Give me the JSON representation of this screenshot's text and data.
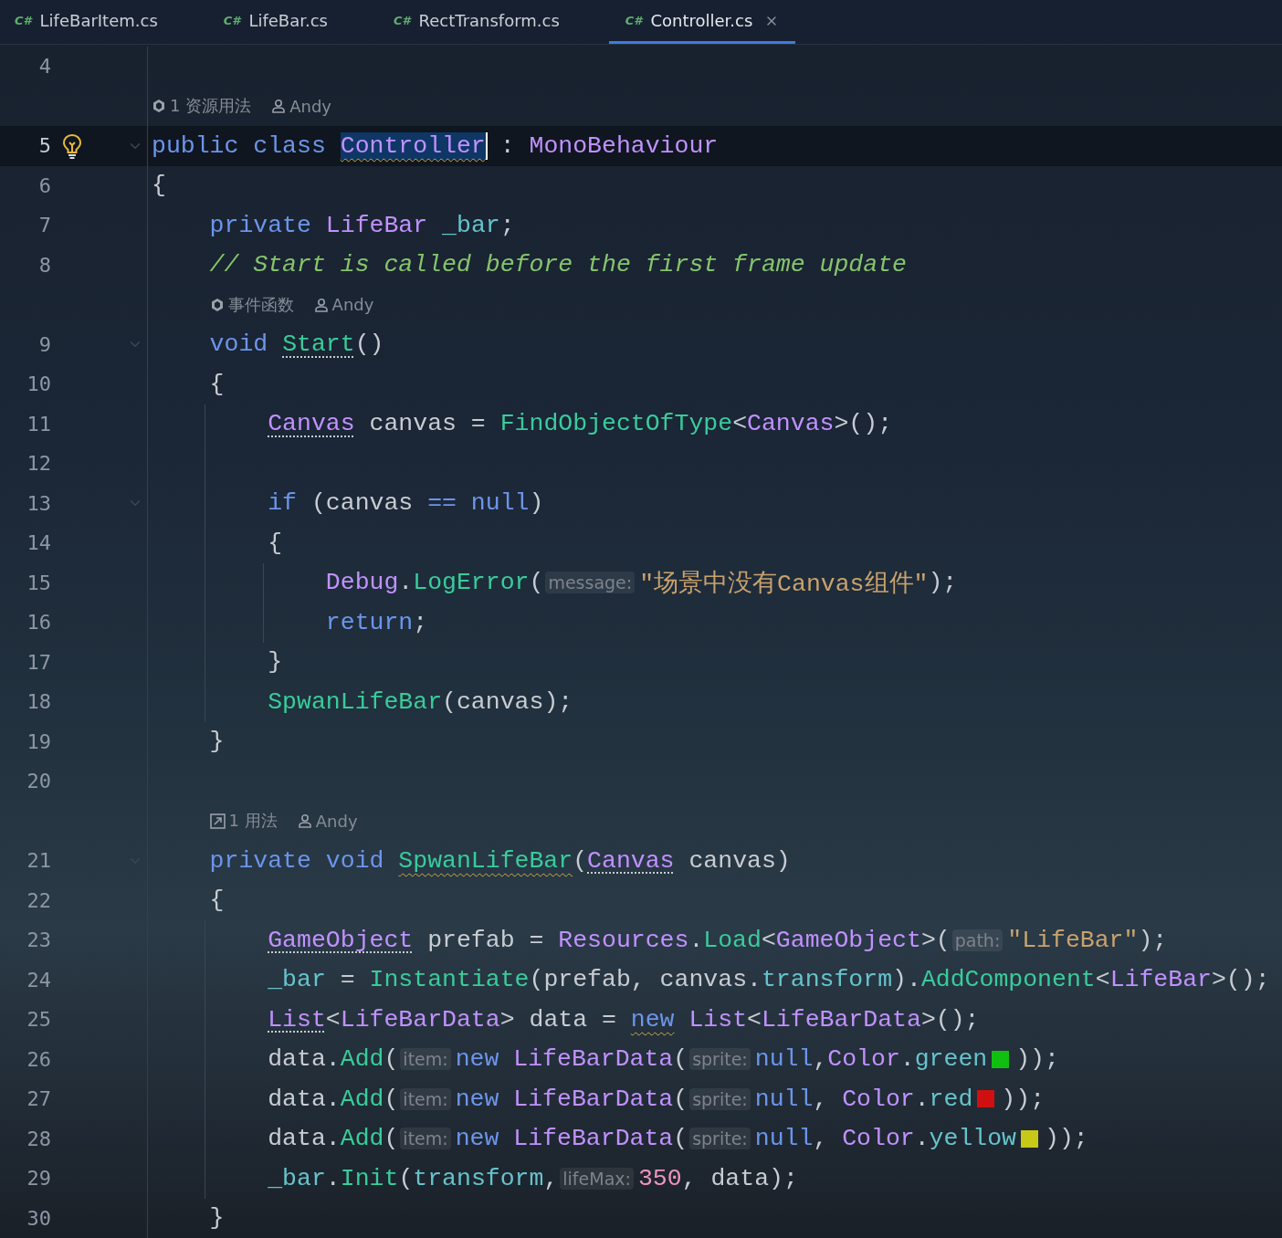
{
  "tabs": [
    {
      "icon_text": "C#",
      "label": "LifeBarItem.cs",
      "selected": false
    },
    {
      "icon_text": "C#",
      "label": "LifeBar.cs",
      "selected": false
    },
    {
      "icon_text": "C#",
      "label": "RectTransform.cs",
      "selected": false
    },
    {
      "icon_text": "C#",
      "label": "Controller.cs",
      "selected": true
    }
  ],
  "lines": [
    {
      "kind": "code",
      "number": "4",
      "current": false,
      "fold": false,
      "bulb": false
    },
    {
      "kind": "lens",
      "items": [
        {
          "kind": "unity",
          "text": "1 资源用法"
        },
        {
          "kind": "user",
          "text": "Andy"
        }
      ]
    },
    {
      "kind": "code",
      "number": "5",
      "current": true,
      "fold": true,
      "bulb": true,
      "tokens": [
        {
          "text": "public class ",
          "kind": "kw"
        },
        {
          "text": "Controller",
          "kind": "type",
          "squiggly": true,
          "caret": true
        },
        {
          "text": " : ",
          "kind": "plain"
        },
        {
          "text": "MonoBehaviour",
          "kind": "type"
        }
      ]
    },
    {
      "kind": "code",
      "number": "6",
      "current": false,
      "fold": false,
      "bulb": false,
      "tokens": [
        {
          "text": "{",
          "kind": "open"
        }
      ]
    },
    {
      "kind": "code",
      "number": "7",
      "current": false,
      "fold": false,
      "bulb": false,
      "tokens": [
        {
          "text": "private",
          "kind": "kw"
        },
        {
          "text": " LifeBar",
          "kind": "type"
        },
        {
          "text": " _bar",
          "kind": "field"
        },
        {
          "text": ";",
          "kind": "plain"
        }
      ]
    },
    {
      "kind": "code",
      "number": "8",
      "current": false,
      "fold": false,
      "bulb": false,
      "tokens": [
        {
          "text": "// Start is called before the first frame update",
          "kind": "comment"
        }
      ]
    },
    {
      "kind": "lens",
      "items": [
        {
          "kind": "unity",
          "text": "事件函数"
        },
        {
          "kind": "user",
          "text": "Andy"
        }
      ]
    },
    {
      "kind": "code",
      "number": "9",
      "current": false,
      "fold": true,
      "bulb": false,
      "tokens": [
        {
          "text": "void ",
          "kind": "kw"
        },
        {
          "text": "Start",
          "kind": "method",
          "dotted": true
        },
        {
          "text": "()",
          "kind": "plain"
        }
      ]
    },
    {
      "kind": "code",
      "number": "10",
      "current": false,
      "fold": false,
      "bulb": false,
      "tokens": [
        {
          "text": "{",
          "kind": "open"
        }
      ]
    },
    {
      "kind": "code",
      "number": "11",
      "current": false,
      "fold": false,
      "bulb": false,
      "tokens": [
        {
          "text": "Canvas",
          "kind": "type",
          "dotted": true
        },
        {
          "text": " canvas = ",
          "kind": "plain"
        },
        {
          "text": "FindObjectOfType",
          "kind": "method"
        },
        {
          "text": "<",
          "kind": "plain"
        },
        {
          "text": "Canvas",
          "kind": "type"
        },
        {
          "text": ">();",
          "kind": "plain"
        }
      ]
    },
    {
      "kind": "code",
      "number": "12",
      "current": false,
      "fold": false,
      "bulb": false
    },
    {
      "kind": "code",
      "number": "13",
      "current": false,
      "fold": true,
      "bulb": false,
      "tokens": [
        {
          "text": "if",
          "kind": "kw"
        },
        {
          "text": " (canvas ",
          "kind": "plain"
        },
        {
          "text": "== null",
          "kind": "kw"
        },
        {
          "text": ")",
          "kind": "plain"
        }
      ]
    },
    {
      "kind": "code",
      "number": "14",
      "current": false,
      "fold": false,
      "bulb": false,
      "tokens": [
        {
          "text": "{",
          "kind": "open"
        }
      ]
    },
    {
      "kind": "code",
      "number": "15",
      "current": false,
      "fold": false,
      "bulb": false,
      "tokens": [
        {
          "text": "Debug",
          "kind": "type"
        },
        {
          "text": ".",
          "kind": "plain"
        },
        {
          "text": "LogError",
          "kind": "method"
        },
        {
          "text": "(",
          "kind": "plain"
        },
        {
          "text": "message:",
          "kind": "hint"
        },
        {
          "text": "\"场景中没有Canvas组件\"",
          "kind": "string"
        },
        {
          "text": ");",
          "kind": "plain"
        }
      ]
    },
    {
      "kind": "code",
      "number": "16",
      "current": false,
      "fold": false,
      "bulb": false,
      "tokens": [
        {
          "text": "return",
          "kind": "kw"
        },
        {
          "text": ";",
          "kind": "plain"
        }
      ]
    },
    {
      "kind": "code",
      "number": "17",
      "current": false,
      "fold": false,
      "bulb": false,
      "tokens": [
        {
          "text": "}",
          "kind": "close"
        }
      ]
    },
    {
      "kind": "code",
      "number": "18",
      "current": false,
      "fold": false,
      "bulb": false,
      "tokens": [
        {
          "text": "SpwanLifeBar",
          "kind": "method"
        },
        {
          "text": "(canvas);",
          "kind": "plain"
        }
      ]
    },
    {
      "kind": "code",
      "number": "19",
      "current": false,
      "fold": false,
      "bulb": false,
      "tokens": [
        {
          "text": "}",
          "kind": "close"
        }
      ]
    },
    {
      "kind": "code",
      "number": "20",
      "current": false,
      "fold": false,
      "bulb": false
    },
    {
      "kind": "lens",
      "items": [
        {
          "kind": "usage",
          "text": "1 用法"
        },
        {
          "kind": "user",
          "text": "Andy"
        }
      ]
    },
    {
      "kind": "code",
      "number": "21",
      "current": false,
      "fold": true,
      "bulb": false,
      "tokens": [
        {
          "text": "private void ",
          "kind": "kw"
        },
        {
          "text": "SpwanLifeBar",
          "kind": "method",
          "squiggly": true
        },
        {
          "text": "(",
          "kind": "plain"
        },
        {
          "text": "Canvas",
          "kind": "type",
          "dotted": true
        },
        {
          "text": " canvas)",
          "kind": "plain"
        }
      ]
    },
    {
      "kind": "code",
      "number": "22",
      "current": false,
      "fold": false,
      "bulb": false,
      "tokens": [
        {
          "text": "{",
          "kind": "open"
        }
      ]
    },
    {
      "kind": "code",
      "number": "23",
      "current": false,
      "fold": false,
      "bulb": false,
      "tokens": [
        {
          "text": "GameObject",
          "kind": "type",
          "dotted": true
        },
        {
          "text": " prefab = ",
          "kind": "plain"
        },
        {
          "text": "Resources",
          "kind": "type"
        },
        {
          "text": ".",
          "kind": "plain"
        },
        {
          "text": "Load",
          "kind": "method"
        },
        {
          "text": "<",
          "kind": "plain"
        },
        {
          "text": "GameObject",
          "kind": "type"
        },
        {
          "text": ">(",
          "kind": "plain"
        },
        {
          "text": "path:",
          "kind": "hint"
        },
        {
          "text": "\"LifeBar\"",
          "kind": "string"
        },
        {
          "text": ");",
          "kind": "plain"
        }
      ]
    },
    {
      "kind": "code",
      "number": "24",
      "current": false,
      "fold": false,
      "bulb": false,
      "tokens": [
        {
          "text": "_bar",
          "kind": "field"
        },
        {
          "text": " = ",
          "kind": "plain"
        },
        {
          "text": "Instantiate",
          "kind": "method"
        },
        {
          "text": "(prefab, canvas.",
          "kind": "plain"
        },
        {
          "text": "transform",
          "kind": "field"
        },
        {
          "text": ").",
          "kind": "plain"
        },
        {
          "text": "AddComponent",
          "kind": "method"
        },
        {
          "text": "<",
          "kind": "plain"
        },
        {
          "text": "LifeBar",
          "kind": "type"
        },
        {
          "text": ">();",
          "kind": "plain"
        }
      ]
    },
    {
      "kind": "code",
      "number": "25",
      "current": false,
      "fold": false,
      "bulb": false,
      "tokens": [
        {
          "text": "List",
          "kind": "type",
          "dotted": true
        },
        {
          "text": "<",
          "kind": "plain"
        },
        {
          "text": "LifeBarData",
          "kind": "type"
        },
        {
          "text": "> data = ",
          "kind": "plain"
        },
        {
          "text": "new",
          "kind": "kw",
          "squiggly": true
        },
        {
          "text": " List",
          "kind": "type"
        },
        {
          "text": "<",
          "kind": "plain"
        },
        {
          "text": "LifeBarData",
          "kind": "type"
        },
        {
          "text": ">();",
          "kind": "plain"
        }
      ]
    },
    {
      "kind": "code",
      "number": "26",
      "current": false,
      "fold": false,
      "bulb": false,
      "tokens": [
        {
          "text": "data.",
          "kind": "plain"
        },
        {
          "text": "Add",
          "kind": "method"
        },
        {
          "text": "(",
          "kind": "plain"
        },
        {
          "text": "item:",
          "kind": "hint"
        },
        {
          "text": "new",
          "kind": "kw"
        },
        {
          "text": " LifeBarData",
          "kind": "type"
        },
        {
          "text": "(",
          "kind": "plain"
        },
        {
          "text": "sprite:",
          "kind": "hint"
        },
        {
          "text": "null",
          "kind": "kw"
        },
        {
          "text": ",",
          "kind": "plain"
        },
        {
          "text": "Color",
          "kind": "type"
        },
        {
          "text": ".",
          "kind": "plain"
        },
        {
          "text": "green",
          "kind": "field"
        },
        {
          "kind": "swatch",
          "color": "#10c010"
        },
        {
          "text": "));",
          "kind": "plain"
        }
      ]
    },
    {
      "kind": "code",
      "number": "27",
      "current": false,
      "fold": false,
      "bulb": false,
      "tokens": [
        {
          "text": "data.",
          "kind": "plain"
        },
        {
          "text": "Add",
          "kind": "method"
        },
        {
          "text": "(",
          "kind": "plain"
        },
        {
          "text": "item:",
          "kind": "hint"
        },
        {
          "text": "new",
          "kind": "kw"
        },
        {
          "text": " LifeBarData",
          "kind": "type"
        },
        {
          "text": "(",
          "kind": "plain"
        },
        {
          "text": "sprite:",
          "kind": "hint"
        },
        {
          "text": "null",
          "kind": "kw"
        },
        {
          "text": ", ",
          "kind": "plain"
        },
        {
          "text": "Color",
          "kind": "type"
        },
        {
          "text": ".",
          "kind": "plain"
        },
        {
          "text": "red",
          "kind": "field"
        },
        {
          "kind": "swatch",
          "color": "#d01010"
        },
        {
          "text": "));",
          "kind": "plain"
        }
      ]
    },
    {
      "kind": "code",
      "number": "28",
      "current": false,
      "fold": false,
      "bulb": false,
      "tokens": [
        {
          "text": "data.",
          "kind": "plain"
        },
        {
          "text": "Add",
          "kind": "method"
        },
        {
          "text": "(",
          "kind": "plain"
        },
        {
          "text": "item:",
          "kind": "hint"
        },
        {
          "text": "new",
          "kind": "kw"
        },
        {
          "text": " LifeBarData",
          "kind": "type"
        },
        {
          "text": "(",
          "kind": "plain"
        },
        {
          "text": "sprite:",
          "kind": "hint"
        },
        {
          "text": "null",
          "kind": "kw"
        },
        {
          "text": ", ",
          "kind": "plain"
        },
        {
          "text": "Color",
          "kind": "type"
        },
        {
          "text": ".",
          "kind": "plain"
        },
        {
          "text": "yellow",
          "kind": "field"
        },
        {
          "kind": "swatch",
          "color": "#c8c818"
        },
        {
          "text": "));",
          "kind": "plain"
        }
      ]
    },
    {
      "kind": "code",
      "number": "29",
      "current": false,
      "fold": false,
      "bulb": false,
      "tokens": [
        {
          "text": "_bar",
          "kind": "field"
        },
        {
          "text": ".",
          "kind": "plain"
        },
        {
          "text": "Init",
          "kind": "method"
        },
        {
          "text": "(",
          "kind": "plain"
        },
        {
          "text": "transform",
          "kind": "field"
        },
        {
          "text": ",",
          "kind": "plain"
        },
        {
          "text": "lifeMax:",
          "kind": "hint"
        },
        {
          "text": "350",
          "kind": "number"
        },
        {
          "text": ", data);",
          "kind": "plain"
        }
      ]
    },
    {
      "kind": "code",
      "number": "30",
      "current": false,
      "fold": false,
      "bulb": false,
      "tokens": [
        {
          "text": "}",
          "kind": "close"
        }
      ]
    }
  ]
}
